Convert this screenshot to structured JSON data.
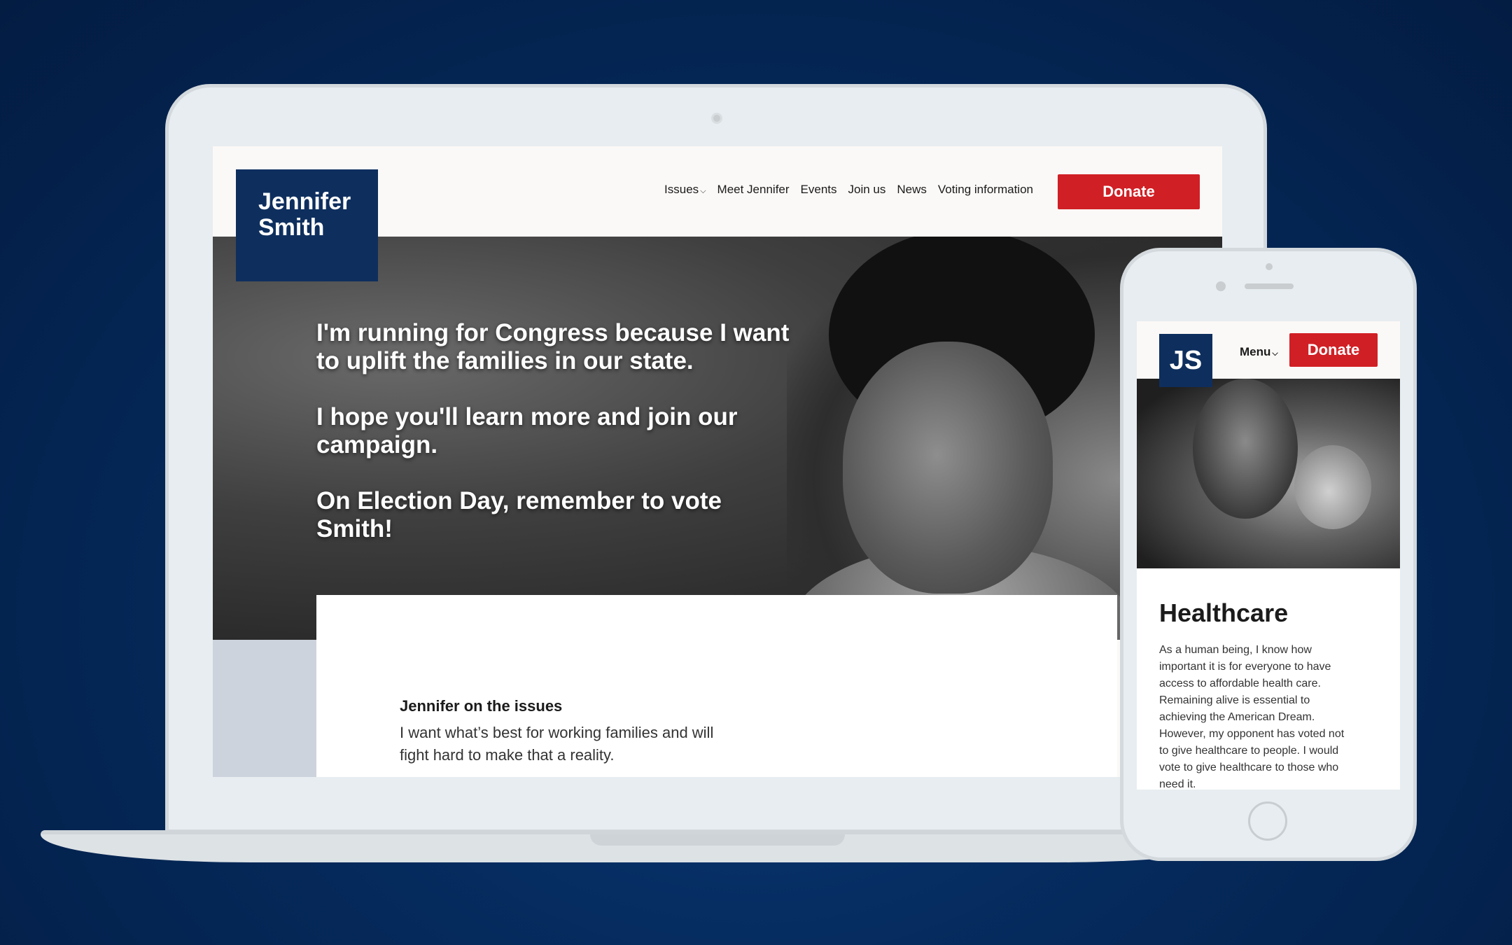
{
  "desktop": {
    "logo": {
      "line1": "Jennifer",
      "line2": "Smith"
    },
    "nav": {
      "items": [
        "Issues",
        "Meet Jennifer",
        "Events",
        "Join us",
        "News",
        "Voting information"
      ],
      "donate_label": "Donate"
    },
    "hero": {
      "paragraphs": [
        "I'm running for Congress because I want to uplift the families in our state.",
        "I hope you'll learn more and join our campaign.",
        "On Election Day, remember to vote Smith!"
      ]
    },
    "issues_card": {
      "title": "Jennifer on the issues",
      "body": "I want what’s best for working families and will fight hard to make that a reality."
    }
  },
  "mobile": {
    "logo": "JS",
    "menu_label": "Menu",
    "donate_label": "Donate",
    "section_title": "Healthcare",
    "section_body": "As a human being, I know how important it is for everyone to have access to affordable health care. Remaining alive is essential to achieving the American Dream. However, my opponent has voted not to give healthcare to people. I would vote to give healthcare to those who need it."
  },
  "colors": {
    "brand_navy": "#0e2f5e",
    "donate_red": "#d01f25",
    "background": "#052a5c"
  }
}
